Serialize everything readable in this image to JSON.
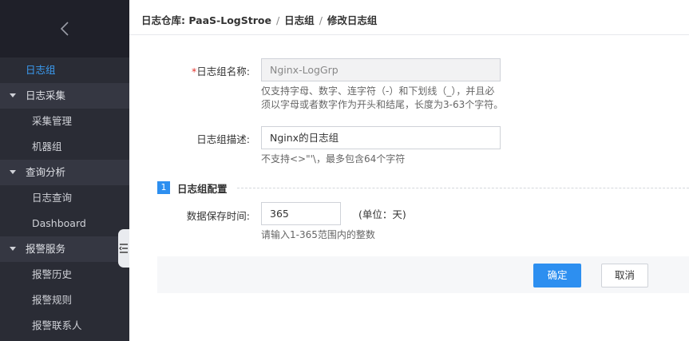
{
  "breadcrumb": {
    "root": "日志仓库: PaaS-LogStroe",
    "level2": "日志组",
    "current": "修改日志组",
    "separator": "/"
  },
  "sidebar": {
    "items": [
      {
        "label": "日志组",
        "kind": "active"
      },
      {
        "label": "日志采集",
        "kind": "group"
      },
      {
        "label": "采集管理",
        "kind": "child"
      },
      {
        "label": "机器组",
        "kind": "child"
      },
      {
        "label": "查询分析",
        "kind": "group"
      },
      {
        "label": "日志查询",
        "kind": "child"
      },
      {
        "label": "Dashboard",
        "kind": "child"
      },
      {
        "label": "报警服务",
        "kind": "group"
      },
      {
        "label": "报警历史",
        "kind": "child"
      },
      {
        "label": "报警规则",
        "kind": "child"
      },
      {
        "label": "报警联系人",
        "kind": "child"
      }
    ],
    "active_color": "#3b9cf2"
  },
  "form": {
    "name_required_mark": "*",
    "name_label": "日志组名称:",
    "name_value": "Nginx-LogGrp",
    "name_hint_line1": "仅支持字母、数字、连字符（-）和下划线（_），并且必",
    "name_hint_line2": "须以字母或者数字作为开头和结尾，长度为3-63个字符。",
    "desc_label": "日志组描述:",
    "desc_value": "Nginx的日志组",
    "desc_hint": "不支持<>\"'\\，最多包含64个字符"
  },
  "config": {
    "section_number": "1",
    "section_title": "日志组配置",
    "retention_label": "数据保存时间:",
    "retention_value": "365",
    "retention_unit": "(单位：天)",
    "retention_hint": "请输入1-365范围内的整数"
  },
  "actions": {
    "confirm_label": "确定",
    "cancel_label": "取消"
  },
  "colors": {
    "primary": "#2d8ff0",
    "sidebar_bg": "#2a2c35",
    "required": "#e3322b"
  },
  "icons": {
    "back": "chevron-left-icon",
    "collapse": "collapse-menu-icon"
  }
}
